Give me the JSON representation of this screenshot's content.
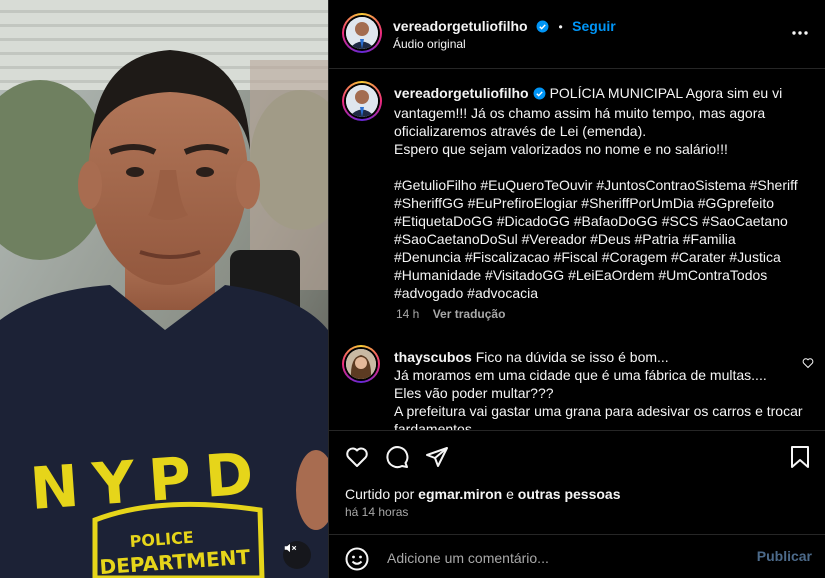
{
  "post": {
    "username": "vereadorgetuliofilho",
    "follow_label": "Seguir",
    "separator": "•",
    "audio": "Áudio original"
  },
  "caption": {
    "username": "vereadorgetuliofilho",
    "text": "POLÍCIA MUNICIPAL Agora sim eu vi vantagem!!! Já os chamo assim há muito tempo, mas agora oficializaremos através de Lei (emenda).\nEspero que sejam valorizados no nome e no salário!!!\n\n#GetulioFilho #EuQueroTeOuvir #JuntosContraoSistema #Sheriff #SheriffGG #EuPrefiroElogiar #SheriffPorUmDia #GGprefeito #EtiquetaDoGG #DicadoGG #BafaoDoGG #SCS #SaoCaetano #SaoCaetanoDoSul #Vereador #Deus #Patria #Familia #Denuncia #Fiscalizacao #Fiscal #Coragem #Carater #Justica #Humanidade #VisitadoGG #LeiEaOrdem #UmContraTodos #advogado #advocacia",
    "age": "14 h",
    "translate": "Ver tradução"
  },
  "comment": {
    "username": "thayscubos",
    "text": "Fico na dúvida se isso é bom...\nJá moramos em uma cidade que é uma fábrica de multas....\nEles vão poder multar???\nA prefeitura vai gastar uma grana para adesivar os carros e trocar fardamentos..."
  },
  "likes": {
    "prefix": "Curtido por",
    "user": "egmar.miron",
    "conj": "e",
    "others": "outras pessoas"
  },
  "time": "há 14 horas",
  "add_comment": {
    "placeholder": "Adicione um comentário...",
    "publish": "Publicar"
  },
  "shirt": {
    "letters": "NYPD",
    "badge_line1": "POLICE",
    "badge_line2": "DEPARTMENT"
  },
  "colors": {
    "accent": "#0095f6",
    "background": "#000000",
    "border": "#262626",
    "muted_text": "#a8a8a8",
    "shirt": "#1c2236",
    "shirt_print": "#e6d51a"
  },
  "icons": {
    "verified": "verified-badge-icon",
    "more": "more-options-icon",
    "like": "heart-icon",
    "comment": "comment-icon",
    "share": "share-icon",
    "save": "bookmark-icon",
    "emoji": "emoji-icon",
    "mute": "speaker-muted-icon"
  }
}
